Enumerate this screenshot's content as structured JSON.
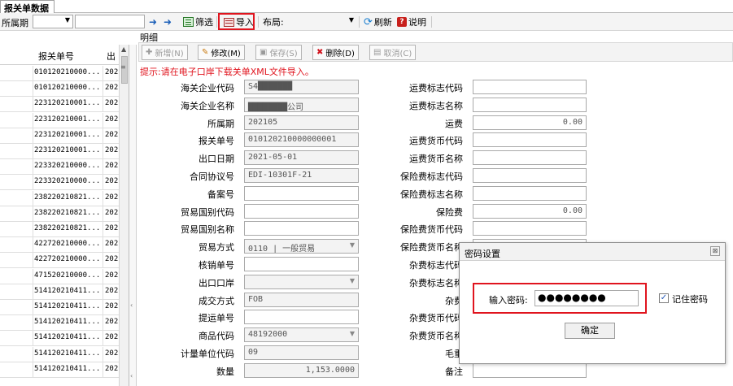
{
  "tab": {
    "label": "报关单数据"
  },
  "toolbar": {
    "period_label": "所属期",
    "period_value": "",
    "search_value": "",
    "filter_label": "筛选",
    "import_label": "导入",
    "layout_label": "布局:",
    "layout_value": "",
    "refresh_label": "刷新",
    "help_label": "说明"
  },
  "grid": {
    "col_no": "报关单号",
    "col_date": "出",
    "rows": [
      {
        "no": "010120210000...",
        "d": "202"
      },
      {
        "no": "010120210000...",
        "d": "202"
      },
      {
        "no": "223120210001...",
        "d": "202"
      },
      {
        "no": "223120210001...",
        "d": "202"
      },
      {
        "no": "223120210001...",
        "d": "202"
      },
      {
        "no": "223120210001...",
        "d": "202"
      },
      {
        "no": "223320210000...",
        "d": "202"
      },
      {
        "no": "223320210000...",
        "d": "202"
      },
      {
        "no": "238220210821...",
        "d": "202"
      },
      {
        "no": "238220210821...",
        "d": "202"
      },
      {
        "no": "238220210821...",
        "d": "202"
      },
      {
        "no": "422720210000...",
        "d": "202"
      },
      {
        "no": "422720210000...",
        "d": "202"
      },
      {
        "no": "471520210000...",
        "d": "202"
      },
      {
        "no": "514120210411...",
        "d": "202"
      },
      {
        "no": "514120210411...",
        "d": "202"
      },
      {
        "no": "514120210411...",
        "d": "202"
      },
      {
        "no": "514120210411...",
        "d": "202"
      },
      {
        "no": "514120210411...",
        "d": "202"
      },
      {
        "no": "514120210411...",
        "d": "202"
      }
    ]
  },
  "detail": {
    "title": "明细",
    "buttons": {
      "add": "新增(N)",
      "edit": "修改(M)",
      "save": "保存(S)",
      "delete": "删除(D)",
      "cancel": "取消(C)"
    },
    "hint": "提示:请在电子口岸下载关单XML文件导入。",
    "left_fields": [
      {
        "label": "海关企业代码",
        "value": "S4███████"
      },
      {
        "label": "海关企业名称",
        "value": "████████公司"
      },
      {
        "label": "所属期",
        "value": "202105"
      },
      {
        "label": "报关单号",
        "value": "010120210000000001"
      },
      {
        "label": "出口日期",
        "value": "2021-05-01"
      },
      {
        "label": "合同协议号",
        "value": "EDI-10301F-21"
      },
      {
        "label": "备案号",
        "value": ""
      },
      {
        "label": "贸易国别代码",
        "value": ""
      },
      {
        "label": "贸易国别名称",
        "value": ""
      },
      {
        "label": "贸易方式",
        "value": "0110 | 一般贸易"
      },
      {
        "label": "核销单号",
        "value": ""
      },
      {
        "label": "出口口岸",
        "value": ""
      },
      {
        "label": "成交方式",
        "value": "FOB"
      },
      {
        "label": "提运单号",
        "value": ""
      },
      {
        "label": "商品代码",
        "value": "48192000"
      },
      {
        "label": "计量单位代码",
        "value": "09"
      },
      {
        "label": "数量",
        "value": "1,153.0000"
      }
    ],
    "right_fields": [
      {
        "label": "运费标志代码",
        "value": ""
      },
      {
        "label": "运费标志名称",
        "value": ""
      },
      {
        "label": "运费",
        "value": "0.00"
      },
      {
        "label": "运费货币代码",
        "value": ""
      },
      {
        "label": "运费货币名称",
        "value": ""
      },
      {
        "label": "保险费标志代码",
        "value": ""
      },
      {
        "label": "保险费标志名称",
        "value": ""
      },
      {
        "label": "保险费",
        "value": "0.00"
      },
      {
        "label": "保险费货币代码",
        "value": ""
      },
      {
        "label": "保险费货币名称",
        "value": ""
      },
      {
        "label": "杂费标志代码",
        "value": ""
      },
      {
        "label": "杂费标志名称",
        "value": ""
      },
      {
        "label": "杂费",
        "value": ""
      },
      {
        "label": "杂费货币代码",
        "value": ""
      },
      {
        "label": "杂费货币名称",
        "value": ""
      },
      {
        "label": "毛重",
        "value": ""
      },
      {
        "label": "备注",
        "value": ""
      }
    ]
  },
  "dialog": {
    "title": "密码设置",
    "password_label": "输入密码:",
    "password_value": "●●●●●●●●",
    "remember_label": "记住密码",
    "remember_checked": "✓",
    "ok_label": "确定"
  },
  "colors": {
    "accent_red": "#e0141e",
    "hint_red": "#e0141e"
  }
}
